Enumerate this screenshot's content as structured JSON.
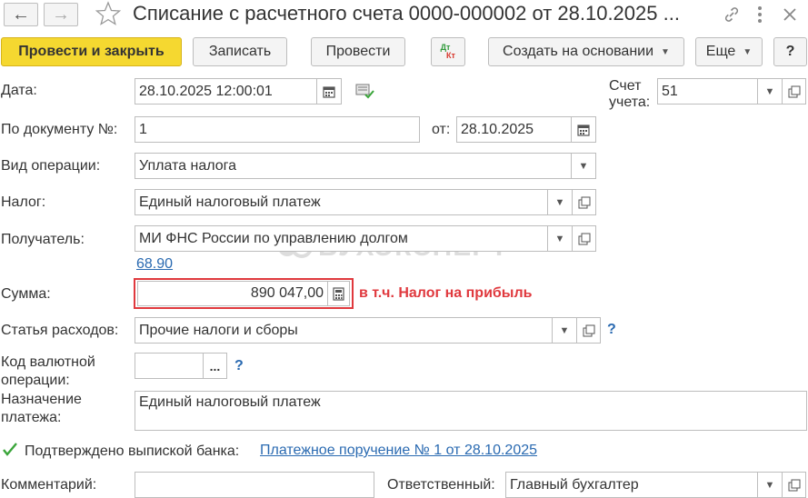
{
  "window": {
    "title": "Списание с расчетного счета 0000-000002 от 28.10.2025 ..."
  },
  "toolbar": {
    "post_and_close": "Провести и закрыть",
    "save": "Записать",
    "post": "Провести",
    "dtkt_top": "Дт",
    "dtkt_bottom": "Кт",
    "create_based": "Создать на основании",
    "more": "Еще",
    "help": "?"
  },
  "form": {
    "date_label": "Дата:",
    "date_value": "28.10.2025 12:00:01",
    "account_label_1": "Счет",
    "account_label_2": "учета:",
    "account_value": "51",
    "docnum_label": "По документу №:",
    "docnum_value": "1",
    "from_label": "от:",
    "from_value": "28.10.2025",
    "optype_label": "Вид операции:",
    "optype_value": "Уплата налога",
    "tax_label": "Налог:",
    "tax_value": "Единый налоговый платеж",
    "recipient_label": "Получатель:",
    "recipient_value": "МИ ФНС России по управлению долгом",
    "recipient_link": "68.90",
    "watermark": "БУХЭКСПЕРТ",
    "sum_label": "Сумма:",
    "sum_value": "890 047,00",
    "sum_note": "в т.ч. Налог на прибыль",
    "expense_label": "Статья расходов:",
    "expense_value": "Прочие налоги и сборы",
    "currency_code_label_1": "Код валютной",
    "currency_code_label_2": "операции:",
    "currency_code_value": "",
    "currency_btn": "...",
    "purpose_label_1": "Назначение",
    "purpose_label_2": "платежа:",
    "purpose_value": "Единый налоговый платеж",
    "confirmed_label": "Подтверждено выпиской банка:",
    "confirmed_link": "Платежное поручение № 1 от 28.10.2025",
    "comment_label": "Комментарий:",
    "comment_value": "",
    "responsible_label": "Ответственный:",
    "responsible_value": "Главный бухгалтер",
    "help_mark": "?"
  },
  "colors": {
    "accent_yellow": "#f5d830",
    "link_blue": "#2a6ab1",
    "highlight_red": "#e0393e",
    "check_green": "#3aa53a"
  }
}
